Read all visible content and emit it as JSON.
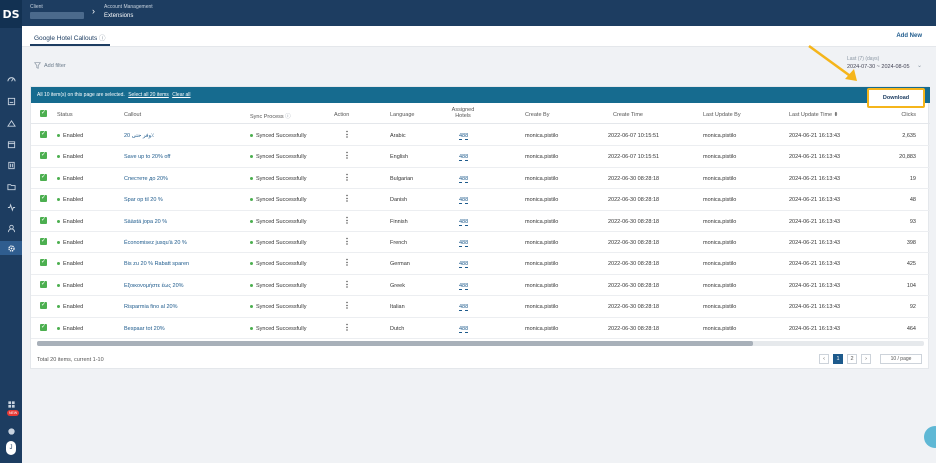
{
  "logo": "DS",
  "topbar": {
    "client_label": "Client",
    "breadcrumb_parent": "Account Management",
    "breadcrumb_current": "Extensions"
  },
  "tab": {
    "label": "Google Hotel Callouts",
    "help": "ⓘ"
  },
  "add_new": "Add New",
  "filter": {
    "add_filter": "Add filter"
  },
  "date_range": {
    "label": "Last (7) (days)",
    "value": "2024-07-30 ~ 2024-08-05"
  },
  "selection": {
    "message": "All 10 item(s) on this page are selected.",
    "select_all": "Select all 20 items",
    "clear_all": "Clear all"
  },
  "download_label": "Download",
  "columns": [
    "Status",
    "Callout",
    "Sync Process",
    "Action",
    "Language",
    "Assigned Hotels",
    "Create By",
    "Create Time",
    "Last Update By",
    "Last Update Time",
    "Clicks"
  ],
  "sync_help": "ⓘ",
  "sort_indicator": "⬍",
  "rows": [
    {
      "status": "Enabled",
      "callout": "وفر حتى 20٪",
      "sync": "Synced Successfully",
      "language": "Arabic",
      "hotels": "488",
      "create_by": "monica.pistilo",
      "create_time": "2022-06-07 10:15:51",
      "update_by": "monica.pistilo",
      "update_time": "2024-06-21 16:13:43",
      "clicks": "2,635"
    },
    {
      "status": "Enabled",
      "callout": "Save up to 20% off",
      "sync": "Synced Successfully",
      "language": "English",
      "hotels": "488",
      "create_by": "monica.pistilo",
      "create_time": "2022-06-07 10:15:51",
      "update_by": "monica.pistilo",
      "update_time": "2024-06-21 16:13:43",
      "clicks": "20,883"
    },
    {
      "status": "Enabled",
      "callout": "Спестете до 20%",
      "sync": "Synced Successfully",
      "language": "Bulgarian",
      "hotels": "488",
      "create_by": "monica.pistilo",
      "create_time": "2022-06-30 08:28:18",
      "update_by": "monica.pistilo",
      "update_time": "2024-06-21 16:13:43",
      "clicks": "19"
    },
    {
      "status": "Enabled",
      "callout": "Spar op til 20 %",
      "sync": "Synced Successfully",
      "language": "Danish",
      "hotels": "488",
      "create_by": "monica.pistilo",
      "create_time": "2022-06-30 08:28:18",
      "update_by": "monica.pistilo",
      "update_time": "2024-06-21 16:13:43",
      "clicks": "48"
    },
    {
      "status": "Enabled",
      "callout": "Säästä jopa 20 %",
      "sync": "Synced Successfully",
      "language": "Finnish",
      "hotels": "488",
      "create_by": "monica.pistilo",
      "create_time": "2022-06-30 08:28:18",
      "update_by": "monica.pistilo",
      "update_time": "2024-06-21 16:13:43",
      "clicks": "93"
    },
    {
      "status": "Enabled",
      "callout": "Économisez jusqu'à 20 %",
      "sync": "Synced Successfully",
      "language": "French",
      "hotels": "488",
      "create_by": "monica.pistilo",
      "create_time": "2022-06-30 08:28:18",
      "update_by": "monica.pistilo",
      "update_time": "2024-06-21 16:13:43",
      "clicks": "398"
    },
    {
      "status": "Enabled",
      "callout": "Bis zu 20 % Rabatt sparen",
      "sync": "Synced Successfully",
      "language": "German",
      "hotels": "488",
      "create_by": "monica.pistilo",
      "create_time": "2022-06-30 08:28:18",
      "update_by": "monica.pistilo",
      "update_time": "2024-06-21 16:13:43",
      "clicks": "425"
    },
    {
      "status": "Enabled",
      "callout": "Εξοικονομήστε έως 20%",
      "sync": "Synced Successfully",
      "language": "Greek",
      "hotels": "488",
      "create_by": "monica.pistilo",
      "create_time": "2022-06-30 08:28:18",
      "update_by": "monica.pistilo",
      "update_time": "2024-06-21 16:13:43",
      "clicks": "104"
    },
    {
      "status": "Enabled",
      "callout": "Risparmia fino al 20%",
      "sync": "Synced Successfully",
      "language": "Italian",
      "hotels": "488",
      "create_by": "monica.pistilo",
      "create_time": "2022-06-30 08:28:18",
      "update_by": "monica.pistilo",
      "update_time": "2024-06-21 16:13:43",
      "clicks": "92"
    },
    {
      "status": "Enabled",
      "callout": "Bespaar tot 20%",
      "sync": "Synced Successfully",
      "language": "Dutch",
      "hotels": "488",
      "create_by": "monica.pistilo",
      "create_time": "2022-06-30 08:28:18",
      "update_by": "monica.pistilo",
      "update_time": "2024-06-21 16:13:43",
      "clicks": "464"
    }
  ],
  "pagination": {
    "total": "Total 20 items, current 1-10",
    "prev": "‹",
    "pages": [
      "1",
      "2"
    ],
    "next": "›",
    "per_page": "10 / page"
  },
  "sidebar_badge": "NEW",
  "user_initial": "J",
  "colors": {
    "nav": "#1d3d61",
    "selection_bar": "#166b8f",
    "status_green": "#4caf50",
    "highlight": "#f5b51b"
  }
}
